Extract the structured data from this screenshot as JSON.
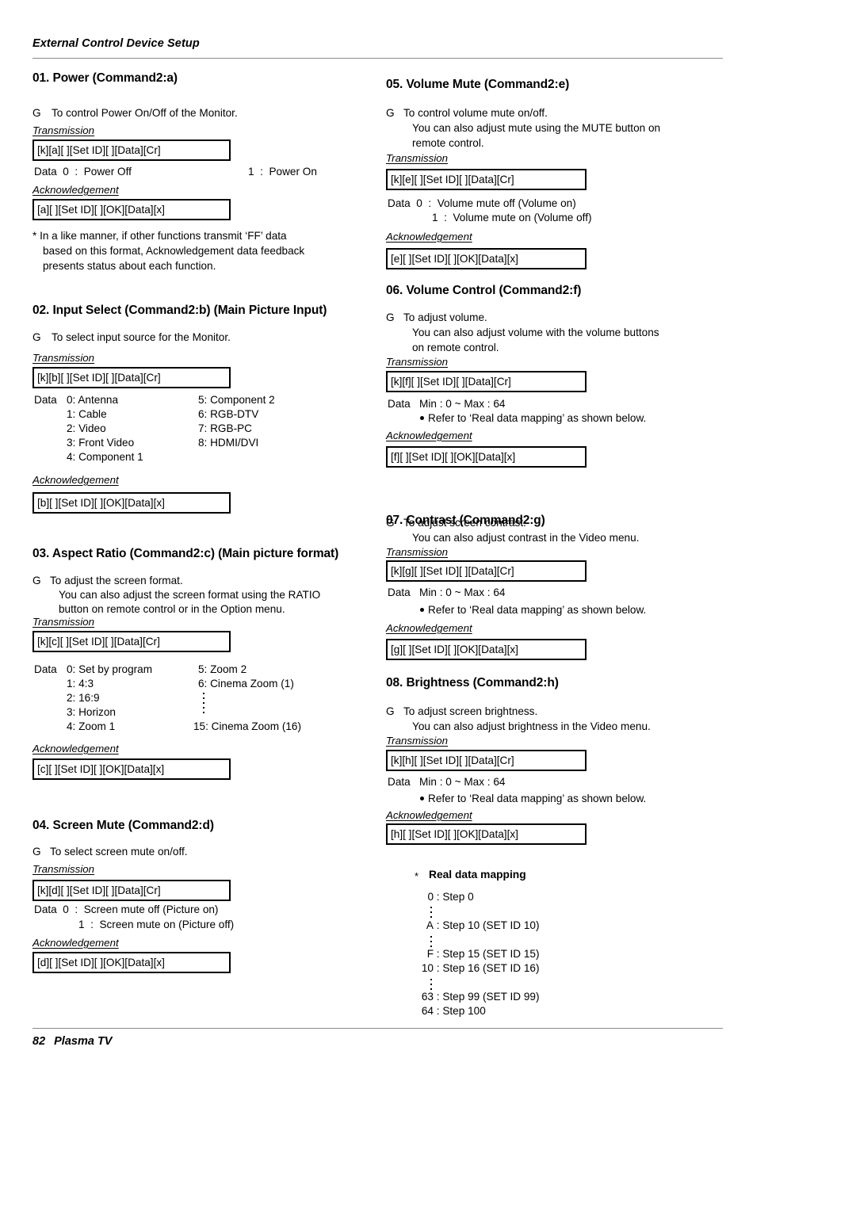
{
  "header": {
    "running_head": "External Control Device Setup"
  },
  "footer": {
    "page_number": "82",
    "product": "Plasma TV"
  },
  "labels": {
    "transmission": "Transmission",
    "acknowledgement": "Acknowledgement",
    "g_mark": "G",
    "data_word": "Data",
    "refer_note": "Refer to ‘Real data mapping’ as shown below."
  },
  "sections": {
    "s01": {
      "title": "01. Power (Command2:a)",
      "desc": "To control Power On/Off of the Monitor.",
      "tx": "[k][a][  ][Set ID][  ][Data][Cr]",
      "data_left": "Data  0  :  Power Off",
      "data_right": "1  :  Power On",
      "ack": "[a][  ][Set ID][  ][OK][Data][x]",
      "note_l1": "* In a like manner, if other functions transmit ‘FF’ data",
      "note_l2": "based on this format, Acknowledgement data feedback",
      "note_l3": "presents status about each function."
    },
    "s02": {
      "title": "02. Input Select (Command2:b) (Main Picture Input)",
      "desc": "To select input source for the Monitor.",
      "tx": "[k][b][  ][Set ID][  ][Data][Cr]",
      "data_word": "Data",
      "col_a": [
        "0: Antenna",
        "1: Cable",
        "2: Video",
        "3: Front Video",
        "4: Component 1"
      ],
      "col_b": [
        "5: Component 2",
        "6: RGB-DTV",
        "7: RGB-PC",
        "8: HDMI/DVI"
      ],
      "ack": "[b][  ][Set ID][  ][OK][Data][x]"
    },
    "s03": {
      "title": "03. Aspect Ratio (Command2:c) (Main picture format)",
      "desc_l1": "To adjust the screen format.",
      "desc_l2": "You can also adjust the screen format using the RATIO",
      "desc_l3": "button on remote control or in the Option menu.",
      "tx": "[k][c][  ][Set ID][  ][Data][Cr]",
      "data_word": "Data",
      "col_a": [
        "0: Set by program",
        "1: 4:3",
        "2: 16:9",
        "3: Horizon",
        "4: Zoom 1"
      ],
      "col_b_top": [
        "5: Zoom 2",
        "6: Cinema Zoom (1)"
      ],
      "col_b_bottom": "15: Cinema Zoom (16)",
      "ack": "[c][  ][Set ID][  ][OK][Data][x]"
    },
    "s04": {
      "title": "04. Screen Mute (Command2:d)",
      "desc": "To select screen mute on/off.",
      "tx": "[k][d][  ][Set ID][  ][Data][Cr]",
      "data_l1": "Data  0  :  Screen mute off (Picture on)",
      "data_l2": "1  :  Screen mute on (Picture off)",
      "ack": "[d][  ][Set ID][  ][OK][Data][x]"
    },
    "s05": {
      "title": "05. Volume Mute (Command2:e)",
      "desc_l1": "To control volume mute on/off.",
      "desc_l2": "You can also adjust mute using the MUTE button on",
      "desc_l3": "remote control.",
      "tx": "[k][e][  ][Set ID][  ][Data][Cr]",
      "data_l1": "Data  0  :  Volume mute off (Volume on)",
      "data_l2": "1  :  Volume mute on (Volume off)",
      "ack": "[e][  ][Set ID][  ][OK][Data][x]"
    },
    "s06": {
      "title": "06. Volume Control (Command2:f)",
      "desc_l1": "To adjust volume.",
      "desc_l2": "You can also adjust volume with the volume buttons",
      "desc_l3": "on remote control.",
      "tx": "[k][f][  ][Set ID][  ][Data][Cr]",
      "data_range": "Data   Min : 0 ~ Max : 64",
      "ack": "[f][  ][Set ID][  ][OK][Data][x]"
    },
    "s07": {
      "title": "07. Contrast (Command2:g)",
      "desc_l1": "To adjust screen contrast.",
      "desc_l2": "You can also adjust contrast in the Video menu.",
      "tx": "[k][g][  ][Set ID][  ][Data][Cr]",
      "data_range": "Data   Min : 0 ~ Max : 64",
      "ack": "[g][  ][Set ID][  ][OK][Data][x]"
    },
    "s08": {
      "title": "08. Brightness (Command2:h)",
      "desc_l1": "To adjust screen brightness.",
      "desc_l2": "You can also adjust brightness in the Video menu.",
      "tx": "[k][h][  ][Set ID][  ][Data][Cr]",
      "data_range": "Data   Min : 0 ~ Max : 64",
      "ack": "[h][  ][Set ID][  ][OK][Data][x]"
    }
  },
  "real_data_mapping": {
    "star": "*",
    "title": "Real data mapping",
    "rows": [
      {
        "key": "0",
        "value": ": Step 0"
      },
      {
        "key": "A",
        "value": ": Step 10 (SET ID 10)"
      },
      {
        "key": "F",
        "value": ": Step 15 (SET ID 15)"
      },
      {
        "key": "10",
        "value": ": Step 16 (SET ID 16)"
      },
      {
        "key": "63",
        "value": ": Step 99 (SET ID 99)"
      },
      {
        "key": "64",
        "value": ": Step 100"
      }
    ]
  }
}
